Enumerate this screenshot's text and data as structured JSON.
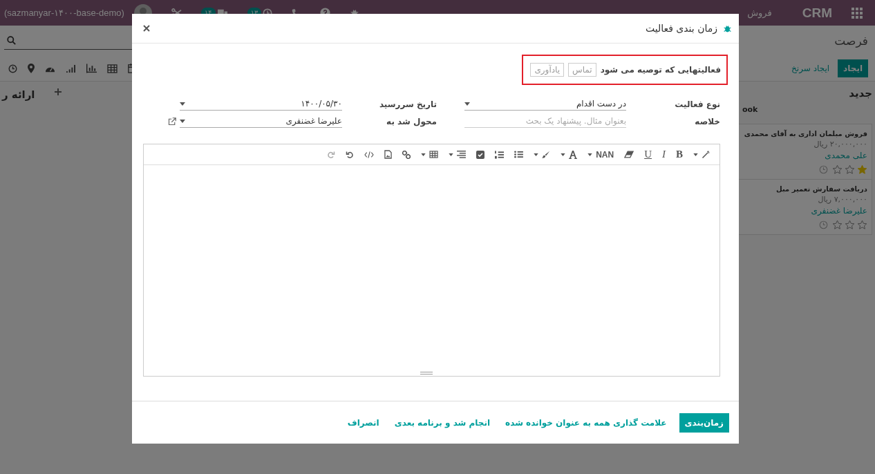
{
  "top_bar": {
    "app_name": "CRM",
    "menu": [
      "فروش"
    ],
    "notifications": [
      {
        "count": "۱۳"
      },
      {
        "count": "۱۴"
      }
    ],
    "user": "(sazmanyar-۱۴۰۰-base-demo)"
  },
  "control_panel": {
    "breadcrumb": "فرصت",
    "create_button": "ایجاد",
    "quick_lead_button": "ایجاد سرنخ"
  },
  "kanban": {
    "columns": [
      {
        "title": "جدید",
        "note": "ook",
        "cards": [
          {
            "title": "فروش مبلمان اداری به آقای محمدی",
            "amount": "۲۰,۰۰۰,۰۰۰ ریال",
            "person": "علی محمدی",
            "stars": 1
          },
          {
            "title": "دریافت سفارش تعمیر مبل",
            "amount": "۷,۰۰۰,۰۰۰ ریال",
            "person": "علیرضا غضنفری",
            "stars": 0
          }
        ]
      },
      {
        "title": "ارائه ر"
      }
    ]
  },
  "dialog": {
    "title": "زمان بندی فعالیت",
    "recommended": {
      "label": "فعالیتهایی که توصیه می شود",
      "activities": [
        "تماس",
        "یادآوری"
      ]
    },
    "fields": [
      {
        "label": "نوع فعالیت",
        "kind": "select",
        "value": "در دست اقدام"
      },
      {
        "label": "تاریخ سررسید",
        "kind": "select",
        "value": "۱۴۰۰/۰۵/۳۰"
      },
      {
        "label": "خلاصه",
        "kind": "input",
        "placeholder": "بعنوان مثال. پیشنهاد یک بحث"
      },
      {
        "label": "محول شد به",
        "kind": "select",
        "value": "علیرضا غضنفری",
        "external_link": true
      }
    ],
    "editor": {
      "bold": "B",
      "italic": "I",
      "underline": "U",
      "font_size": "NAN"
    },
    "buttons": [
      {
        "label": "زمان‌بندی",
        "primary": true
      },
      {
        "label": "علامت گذاری همه به عنوان خوانده شده",
        "primary": false
      },
      {
        "label": "انجام شد و برنامه بعدی",
        "primary": false
      },
      {
        "label": "انصراف",
        "primary": false
      }
    ]
  }
}
